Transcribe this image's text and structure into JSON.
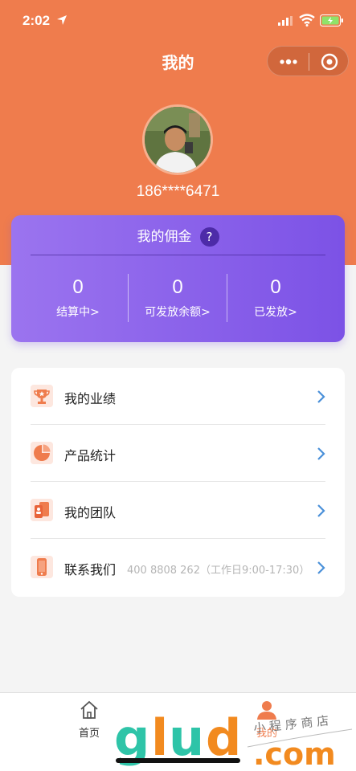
{
  "status_bar": {
    "time": "2:02"
  },
  "nav": {
    "title": "我的"
  },
  "profile": {
    "phone": "186****6471"
  },
  "commission": {
    "title": "我的佣金",
    "help_symbol": "?",
    "stats": [
      {
        "value": "0",
        "label": "结算中>"
      },
      {
        "value": "0",
        "label": "可发放余额>"
      },
      {
        "value": "0",
        "label": "已发放>"
      }
    ]
  },
  "menu": {
    "items": [
      {
        "label": "我的业绩",
        "icon": "trophy-icon"
      },
      {
        "label": "产品统计",
        "icon": "pie-chart-icon"
      },
      {
        "label": "我的团队",
        "icon": "team-icon"
      },
      {
        "label": "联系我们",
        "icon": "phone-icon",
        "extra": "400 8808 262（工作日9:00-17:30）"
      }
    ]
  },
  "tabbar": {
    "tabs": [
      {
        "label": "首页",
        "icon": "home-icon",
        "active": false
      },
      {
        "label": "我的",
        "icon": "user-icon",
        "active": true
      }
    ]
  },
  "colors": {
    "primary": "#ef7c4d",
    "purple_start": "#9b74ef",
    "purple_end": "#7c52e6",
    "chevron": "#4a90d9"
  }
}
